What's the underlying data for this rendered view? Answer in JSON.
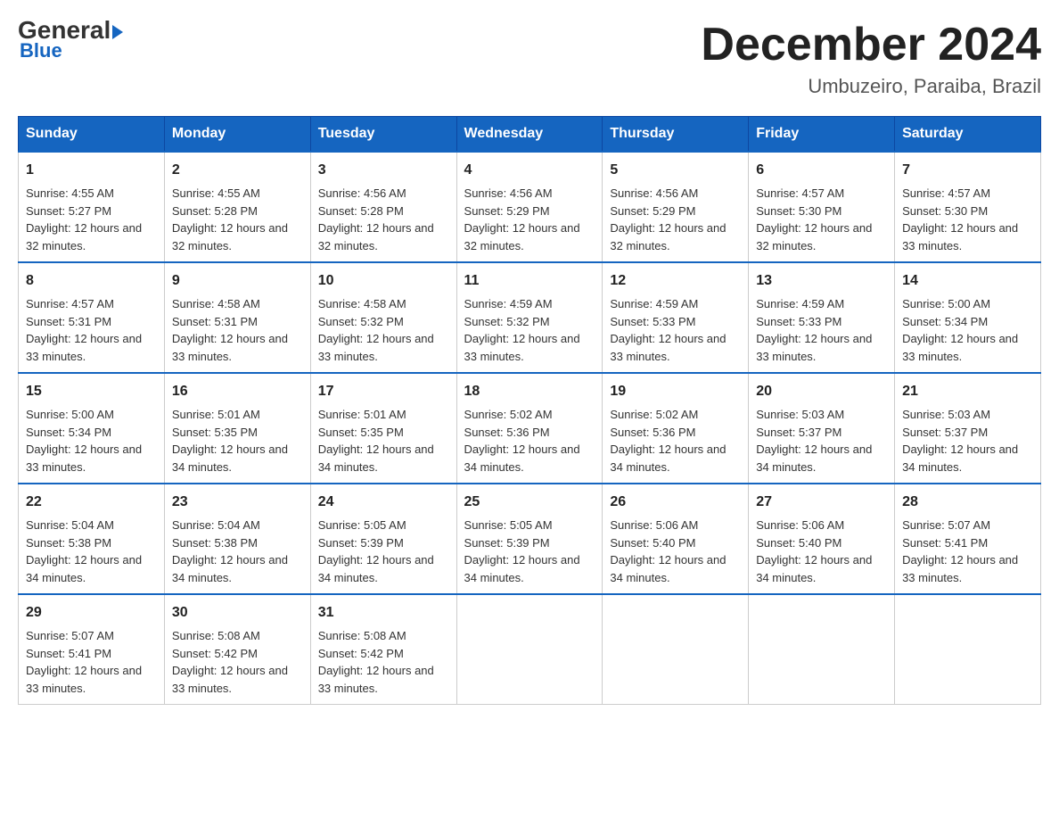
{
  "logo": {
    "line1a": "General",
    "line1b": "Blue",
    "line2": "Blue"
  },
  "header": {
    "title": "December 2024",
    "subtitle": "Umbuzeiro, Paraiba, Brazil"
  },
  "days_of_week": [
    "Sunday",
    "Monday",
    "Tuesday",
    "Wednesday",
    "Thursday",
    "Friday",
    "Saturday"
  ],
  "weeks": [
    [
      {
        "day": "1",
        "sunrise": "4:55 AM",
        "sunset": "5:27 PM",
        "daylight": "12 hours and 32 minutes."
      },
      {
        "day": "2",
        "sunrise": "4:55 AM",
        "sunset": "5:28 PM",
        "daylight": "12 hours and 32 minutes."
      },
      {
        "day": "3",
        "sunrise": "4:56 AM",
        "sunset": "5:28 PM",
        "daylight": "12 hours and 32 minutes."
      },
      {
        "day": "4",
        "sunrise": "4:56 AM",
        "sunset": "5:29 PM",
        "daylight": "12 hours and 32 minutes."
      },
      {
        "day": "5",
        "sunrise": "4:56 AM",
        "sunset": "5:29 PM",
        "daylight": "12 hours and 32 minutes."
      },
      {
        "day": "6",
        "sunrise": "4:57 AM",
        "sunset": "5:30 PM",
        "daylight": "12 hours and 32 minutes."
      },
      {
        "day": "7",
        "sunrise": "4:57 AM",
        "sunset": "5:30 PM",
        "daylight": "12 hours and 33 minutes."
      }
    ],
    [
      {
        "day": "8",
        "sunrise": "4:57 AM",
        "sunset": "5:31 PM",
        "daylight": "12 hours and 33 minutes."
      },
      {
        "day": "9",
        "sunrise": "4:58 AM",
        "sunset": "5:31 PM",
        "daylight": "12 hours and 33 minutes."
      },
      {
        "day": "10",
        "sunrise": "4:58 AM",
        "sunset": "5:32 PM",
        "daylight": "12 hours and 33 minutes."
      },
      {
        "day": "11",
        "sunrise": "4:59 AM",
        "sunset": "5:32 PM",
        "daylight": "12 hours and 33 minutes."
      },
      {
        "day": "12",
        "sunrise": "4:59 AM",
        "sunset": "5:33 PM",
        "daylight": "12 hours and 33 minutes."
      },
      {
        "day": "13",
        "sunrise": "4:59 AM",
        "sunset": "5:33 PM",
        "daylight": "12 hours and 33 minutes."
      },
      {
        "day": "14",
        "sunrise": "5:00 AM",
        "sunset": "5:34 PM",
        "daylight": "12 hours and 33 minutes."
      }
    ],
    [
      {
        "day": "15",
        "sunrise": "5:00 AM",
        "sunset": "5:34 PM",
        "daylight": "12 hours and 33 minutes."
      },
      {
        "day": "16",
        "sunrise": "5:01 AM",
        "sunset": "5:35 PM",
        "daylight": "12 hours and 34 minutes."
      },
      {
        "day": "17",
        "sunrise": "5:01 AM",
        "sunset": "5:35 PM",
        "daylight": "12 hours and 34 minutes."
      },
      {
        "day": "18",
        "sunrise": "5:02 AM",
        "sunset": "5:36 PM",
        "daylight": "12 hours and 34 minutes."
      },
      {
        "day": "19",
        "sunrise": "5:02 AM",
        "sunset": "5:36 PM",
        "daylight": "12 hours and 34 minutes."
      },
      {
        "day": "20",
        "sunrise": "5:03 AM",
        "sunset": "5:37 PM",
        "daylight": "12 hours and 34 minutes."
      },
      {
        "day": "21",
        "sunrise": "5:03 AM",
        "sunset": "5:37 PM",
        "daylight": "12 hours and 34 minutes."
      }
    ],
    [
      {
        "day": "22",
        "sunrise": "5:04 AM",
        "sunset": "5:38 PM",
        "daylight": "12 hours and 34 minutes."
      },
      {
        "day": "23",
        "sunrise": "5:04 AM",
        "sunset": "5:38 PM",
        "daylight": "12 hours and 34 minutes."
      },
      {
        "day": "24",
        "sunrise": "5:05 AM",
        "sunset": "5:39 PM",
        "daylight": "12 hours and 34 minutes."
      },
      {
        "day": "25",
        "sunrise": "5:05 AM",
        "sunset": "5:39 PM",
        "daylight": "12 hours and 34 minutes."
      },
      {
        "day": "26",
        "sunrise": "5:06 AM",
        "sunset": "5:40 PM",
        "daylight": "12 hours and 34 minutes."
      },
      {
        "day": "27",
        "sunrise": "5:06 AM",
        "sunset": "5:40 PM",
        "daylight": "12 hours and 34 minutes."
      },
      {
        "day": "28",
        "sunrise": "5:07 AM",
        "sunset": "5:41 PM",
        "daylight": "12 hours and 33 minutes."
      }
    ],
    [
      {
        "day": "29",
        "sunrise": "5:07 AM",
        "sunset": "5:41 PM",
        "daylight": "12 hours and 33 minutes."
      },
      {
        "day": "30",
        "sunrise": "5:08 AM",
        "sunset": "5:42 PM",
        "daylight": "12 hours and 33 minutes."
      },
      {
        "day": "31",
        "sunrise": "5:08 AM",
        "sunset": "5:42 PM",
        "daylight": "12 hours and 33 minutes."
      },
      null,
      null,
      null,
      null
    ]
  ]
}
